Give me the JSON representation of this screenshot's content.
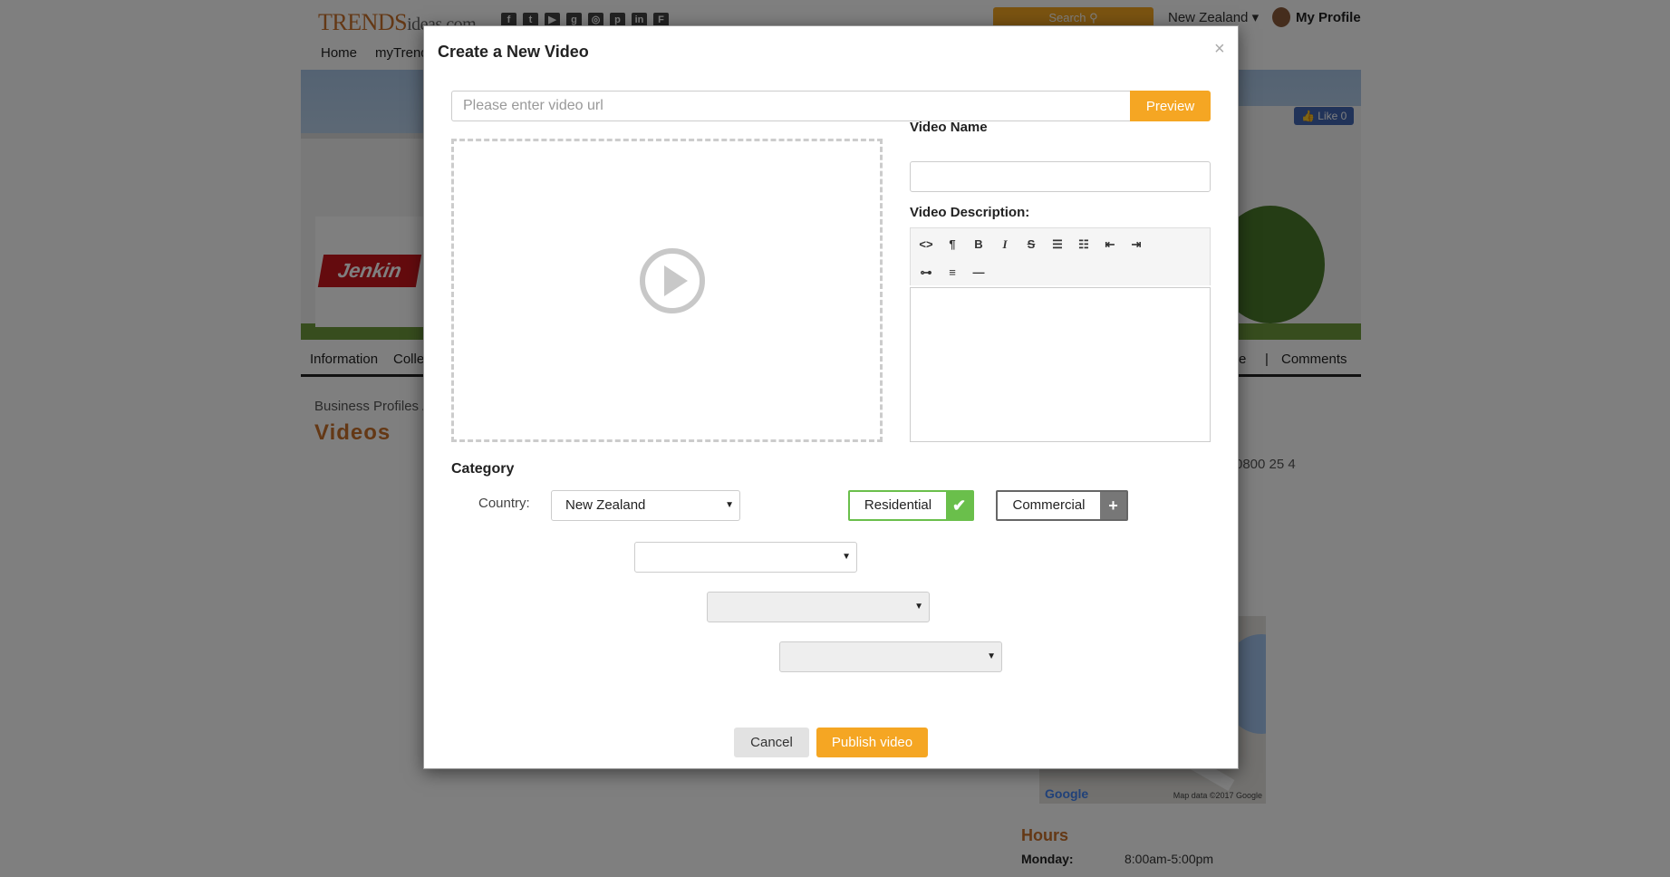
{
  "site": {
    "logo_trends": "TRENDS",
    "logo_ideas": "ideas.com",
    "social_icons": [
      "facebook-icon",
      "twitter-icon",
      "youtube-icon",
      "googleplus-icon",
      "instagram-icon",
      "pinterest-icon",
      "linkedin-icon",
      "flipboard-icon"
    ],
    "search_label": "Search",
    "region": "New Zealand",
    "profile": "My Profile",
    "nav": [
      "Home",
      "myTrend"
    ],
    "fb_like": "Like 0",
    "subnav": [
      "Information",
      "Colle",
      "re",
      "|",
      "Comments"
    ],
    "breadcrumb": "Business Profiles / N",
    "page_title": "Videos",
    "phone_partial": "0800 25 4",
    "map_logo": "Google",
    "map_data": "Map data ©2017 Google",
    "hours_title": "Hours",
    "hours_day": "Monday:",
    "hours_time": "8:00am-5:00pm",
    "brand_color": "#c8702a",
    "accent_color": "#f5a623"
  },
  "modal": {
    "title": "Create a New Video",
    "close": "×",
    "url_placeholder": "Please enter video url",
    "url_value": "",
    "preview_label": "Preview",
    "video_name_label": "Video Name",
    "video_name_value": "",
    "video_desc_label": "Video Description:",
    "toolbar": {
      "row1": [
        "<>",
        "¶",
        "B",
        "I",
        "S",
        "ul",
        "ol",
        "outdent",
        "indent"
      ],
      "row2": [
        "link",
        "align",
        "hr"
      ]
    },
    "category_label": "Category",
    "country_label": "Country:",
    "country_value": "New Zealand",
    "tags": {
      "residential": "Residential",
      "residential_selected": true,
      "commercial": "Commercial",
      "commercial_selected": false
    },
    "cancel_label": "Cancel",
    "publish_label": "Publish video"
  }
}
